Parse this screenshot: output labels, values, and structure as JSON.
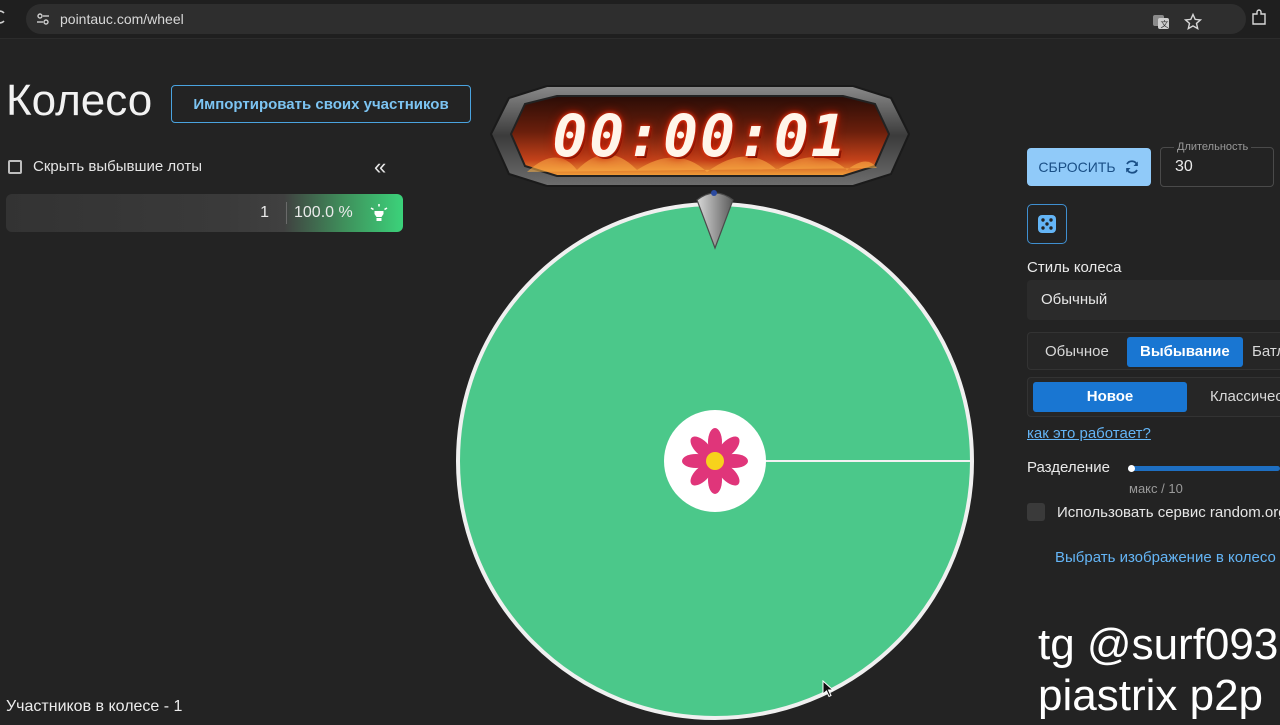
{
  "browser": {
    "url": "pointauc.com/wheel"
  },
  "header": {
    "title": "Колесо",
    "import_label": "Импортировать своих участников"
  },
  "left_panel": {
    "hide_label": "Скрыть выбывшие лоты",
    "collapse_label": "«",
    "lot": {
      "amount": "1",
      "percent": "100.0 %"
    },
    "participants": "Участников в колесе - 1"
  },
  "timer": {
    "value": "00:00:01"
  },
  "right_panel": {
    "reset_label": "СБРОСИТЬ",
    "duration_label": "Длительность",
    "duration_value": "30",
    "style_label": "Стиль колеса",
    "style_value": "Обычный",
    "modes": [
      "Обычное",
      "Выбывание",
      "Батл"
    ],
    "active_mode": "Выбывание",
    "submodes": [
      "Новое",
      "Классическое"
    ],
    "active_submode": "Новое",
    "how_link": "как это работает?",
    "split_label": "Разделение",
    "split_max": "макс / 10",
    "random_label": "Использовать сервис random.org",
    "choose_image": "Выбрать изображение в колесо"
  },
  "watermark": {
    "line1": "tg @surf093",
    "line2": "piastrix p2p"
  },
  "colors": {
    "wheel": "#4bc88a",
    "accent": "#1976d2",
    "link": "#64b5f6",
    "reset_bg": "#90caf9"
  }
}
